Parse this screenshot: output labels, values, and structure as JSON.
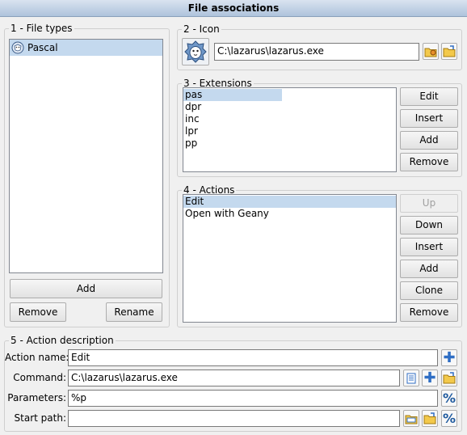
{
  "window": {
    "title": "File associations"
  },
  "file_types": {
    "legend": "1 - File types",
    "items": [
      {
        "label": "Pascal",
        "selected": true
      }
    ],
    "add": "Add",
    "remove": "Remove",
    "rename": "Rename"
  },
  "icon_group": {
    "legend": "2 - Icon",
    "path": "C:\\lazarus\\lazarus.exe"
  },
  "extensions": {
    "legend": "3 - Extensions",
    "items": [
      "pas",
      "dpr",
      "inc",
      "lpr",
      "pp"
    ],
    "selected_index": 0,
    "buttons": {
      "edit": "Edit",
      "insert": "Insert",
      "add": "Add",
      "remove": "Remove"
    }
  },
  "actions": {
    "legend": "4 - Actions",
    "items": [
      "Edit",
      "Open with Geany"
    ],
    "selected_index": 0,
    "buttons": {
      "up": "Up",
      "down": "Down",
      "insert": "Insert",
      "add": "Add",
      "clone": "Clone",
      "remove": "Remove"
    }
  },
  "action_description": {
    "legend": "5 - Action description",
    "action_name_label": "Action name:",
    "action_name_value": "Edit",
    "command_label": "Command:",
    "command_value": "C:\\lazarus\\lazarus.exe",
    "parameters_label": "Parameters:",
    "parameters_value": "%p",
    "start_path_label": "Start path:",
    "start_path_value": ""
  },
  "icons": {
    "pascal": "lazarus-cheetah-icon",
    "folder": "folder-icon",
    "plus": "plus-icon",
    "percent": "percent-variable-icon",
    "document": "document-icon"
  },
  "colors": {
    "selection": "#c4d9ee",
    "title_bar": "#aec3dc",
    "accent_blue": "#2f6ec4"
  }
}
